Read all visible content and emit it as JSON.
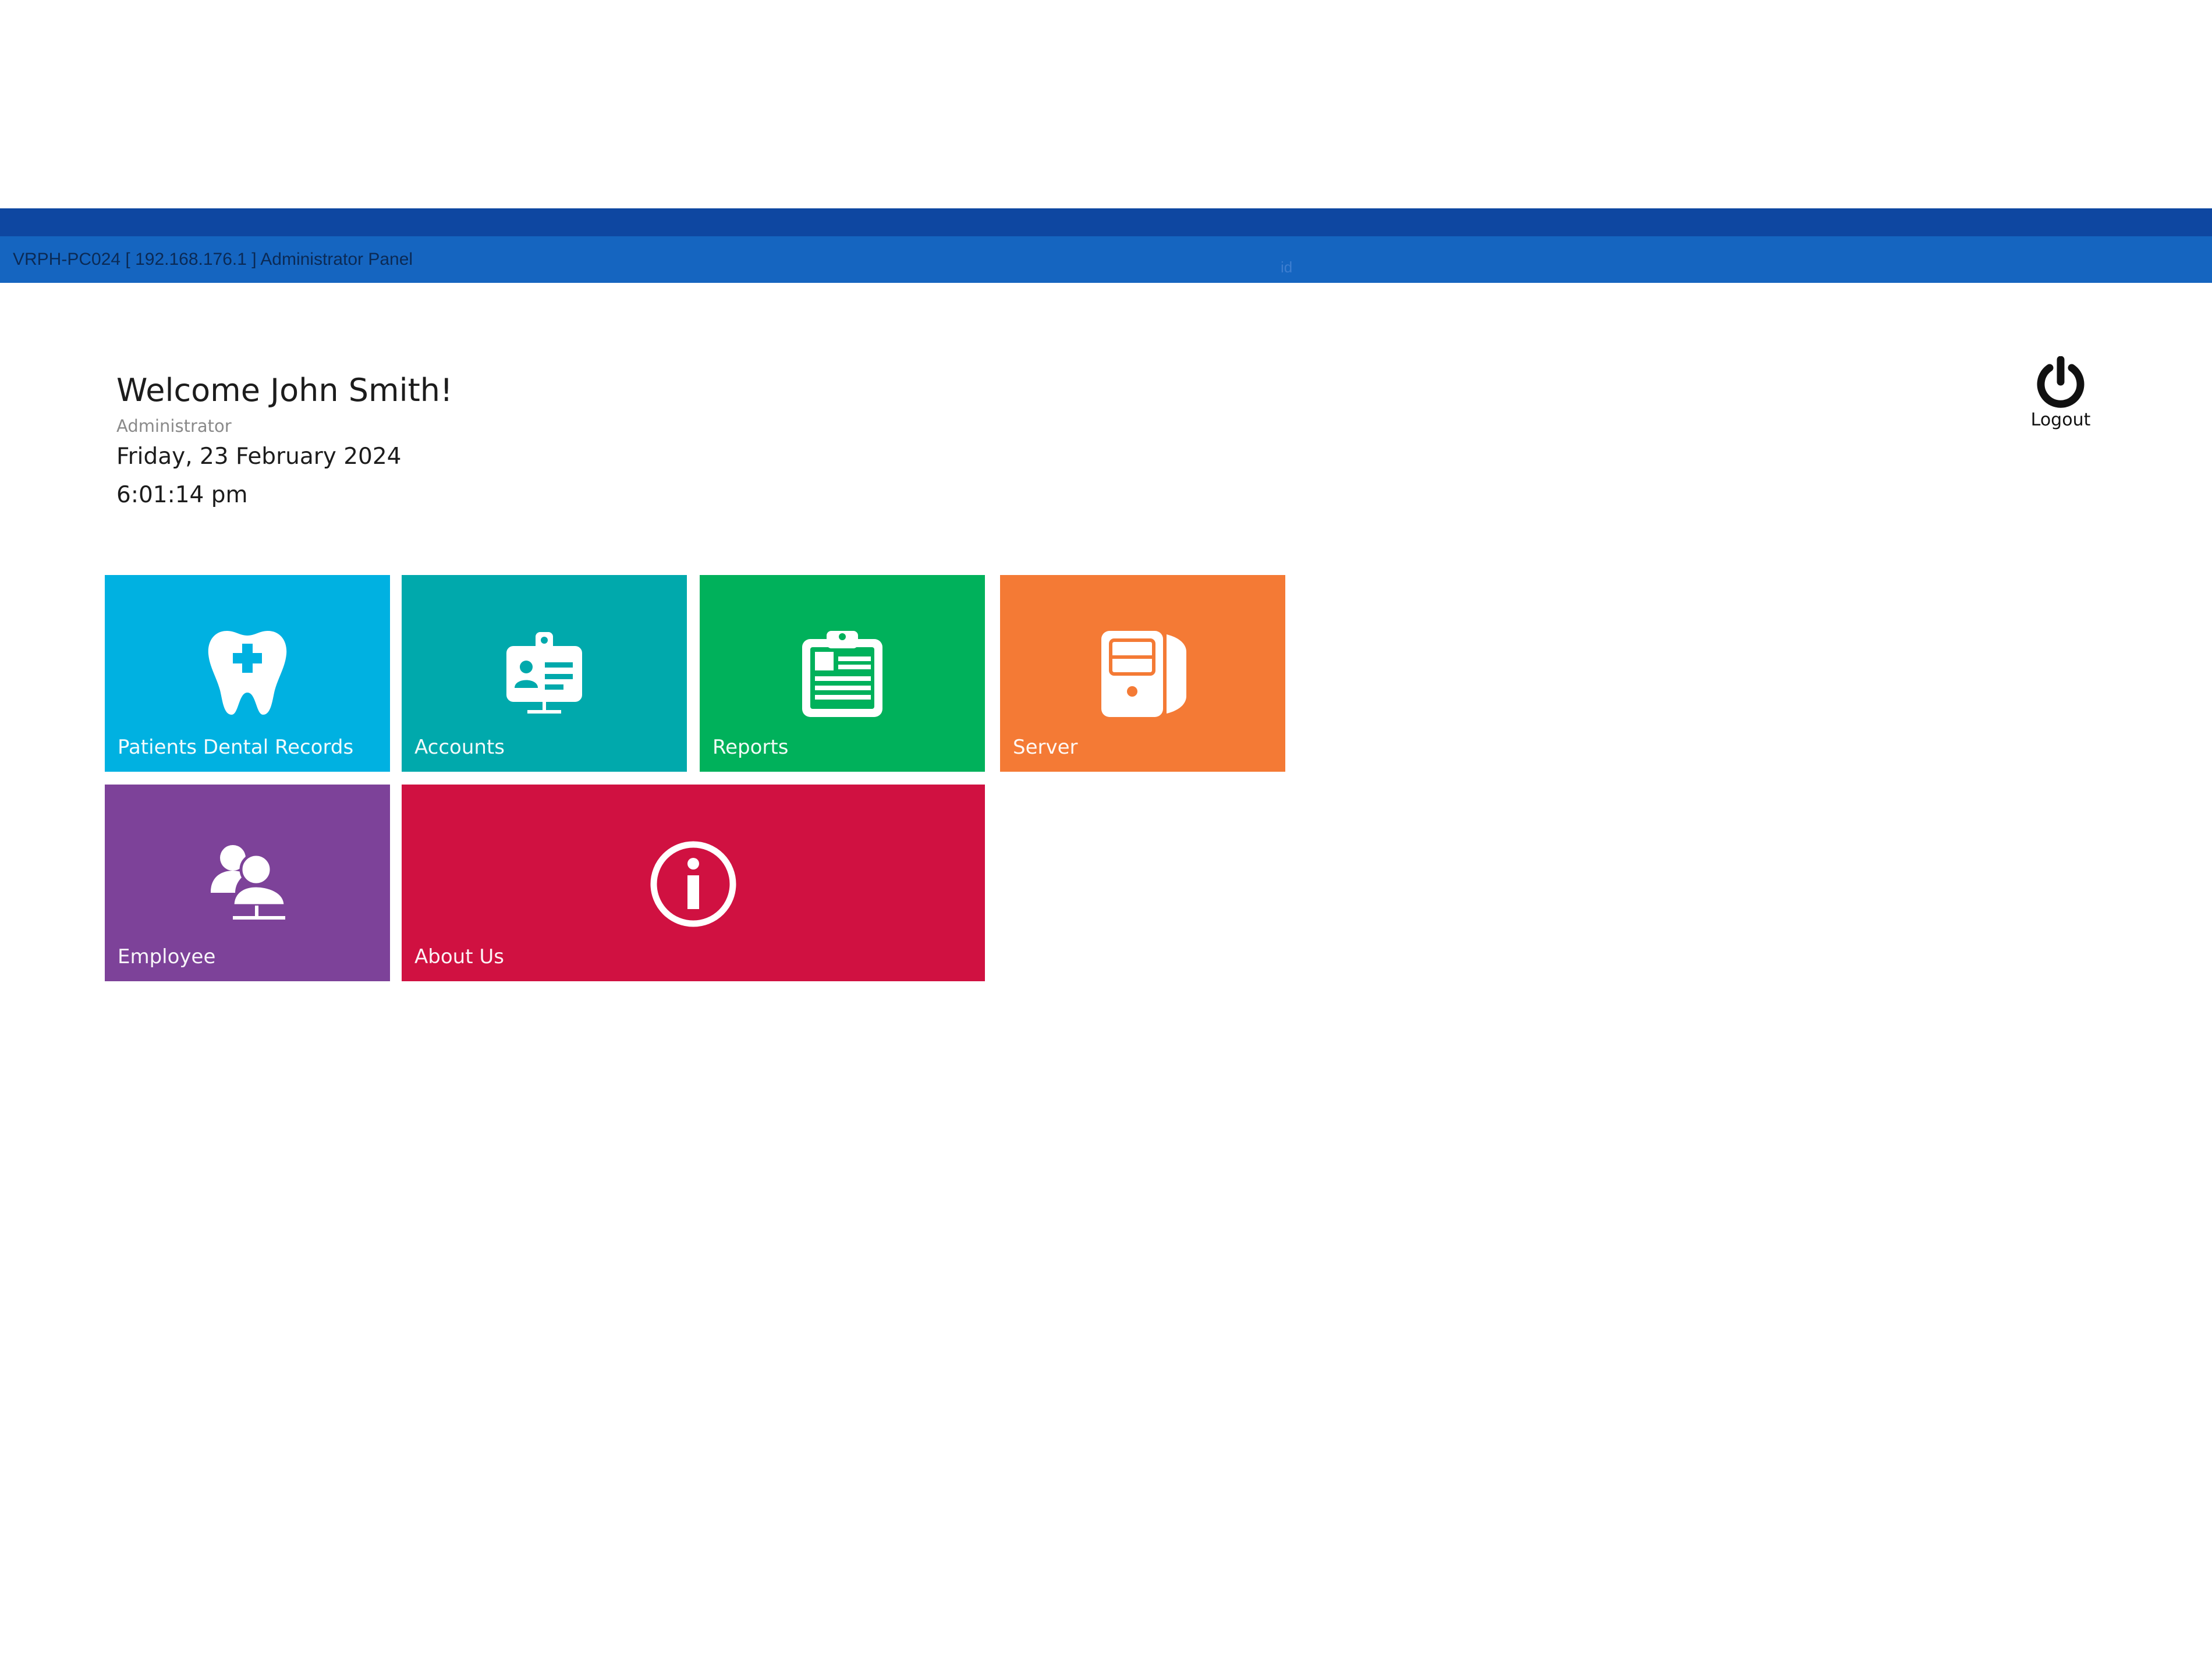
{
  "window": {
    "title": "VRPH-PC024 [ 192.168.176.1 ]  Administrator Panel",
    "id_label": "id",
    "colors": {
      "strip": "#0e47a1",
      "bar": "#1565c0"
    }
  },
  "user": {
    "welcome": "Welcome John Smith!",
    "role": "Administrator",
    "date": "Friday, 23 February 2024",
    "time": "6:01:14 pm"
  },
  "logout": {
    "label": "Logout",
    "icon": "power-icon"
  },
  "tiles": [
    {
      "label": "Patients Dental Records",
      "icon": "tooth-icon",
      "color": "#00b1e1"
    },
    {
      "label": "Accounts",
      "icon": "id-badge-icon",
      "color": "#00a9ac"
    },
    {
      "label": "Reports",
      "icon": "clipboard-icon",
      "color": "#00b15b"
    },
    {
      "label": "Server",
      "icon": "server-icon",
      "color": "#f47a35"
    },
    {
      "label": "Employee",
      "icon": "employee-icon",
      "color": "#7d4299"
    },
    {
      "label": "About Us",
      "icon": "info-icon",
      "color": "#d01141"
    }
  ]
}
